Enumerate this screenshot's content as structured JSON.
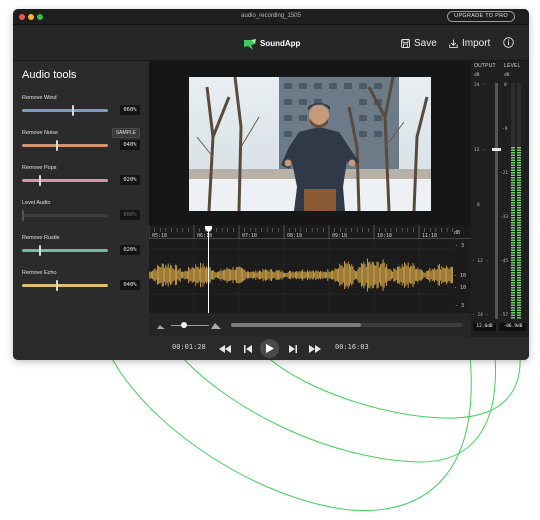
{
  "window": {
    "title": "audio_recording_1505",
    "upgrade_label": "UPGRADE TO PRO"
  },
  "header": {
    "app_name": "SoundApp",
    "save_label": "Save",
    "import_label": "Import"
  },
  "sidebar": {
    "title": "Audio tools",
    "sample_label": "SAMPLE",
    "tools": [
      {
        "label": "Remove Wind",
        "value": "060%",
        "level": 0.6,
        "color": "#86a9d8",
        "enabled": true
      },
      {
        "label": "Remove Noise",
        "value": "040%",
        "level": 0.4,
        "color": "#e8a07a",
        "enabled": true
      },
      {
        "label": "Remove Pops",
        "value": "020%",
        "level": 0.2,
        "color": "#e6a3b5",
        "enabled": true
      },
      {
        "label": "Level Audio",
        "value": "000%",
        "level": 0.0,
        "color": "#5b5b5b",
        "enabled": false
      },
      {
        "label": "Remove Rustle",
        "value": "020%",
        "level": 0.2,
        "color": "#7ec9b0",
        "enabled": true
      },
      {
        "label": "Remove Echo",
        "value": "040%",
        "level": 0.4,
        "color": "#f0cf78",
        "enabled": true
      }
    ]
  },
  "timeline": {
    "ticks": [
      "05:18",
      "06:18",
      "07:18",
      "08:18",
      "09:18",
      "10:18",
      "11:18"
    ],
    "db_unit": "dB",
    "db_labels": [
      "- 3",
      "- 10",
      "- 10",
      "- 3"
    ],
    "waveform_color": "#e8b64c"
  },
  "meters": {
    "output_label": "OUTPUT",
    "level_label": "LEVEL",
    "db_unit": "dB",
    "output_scale": [
      "24 -",
      "12 -",
      "0",
      "- 12 -",
      "- 24 -"
    ],
    "level_scale": [
      "0",
      "-9",
      "-21",
      "-33",
      "-45",
      "-57"
    ],
    "output_value": "12.0dB",
    "level_value": "-06.9dB"
  },
  "transport": {
    "current_time": "00:01:28",
    "total_time": "00:16:03"
  }
}
